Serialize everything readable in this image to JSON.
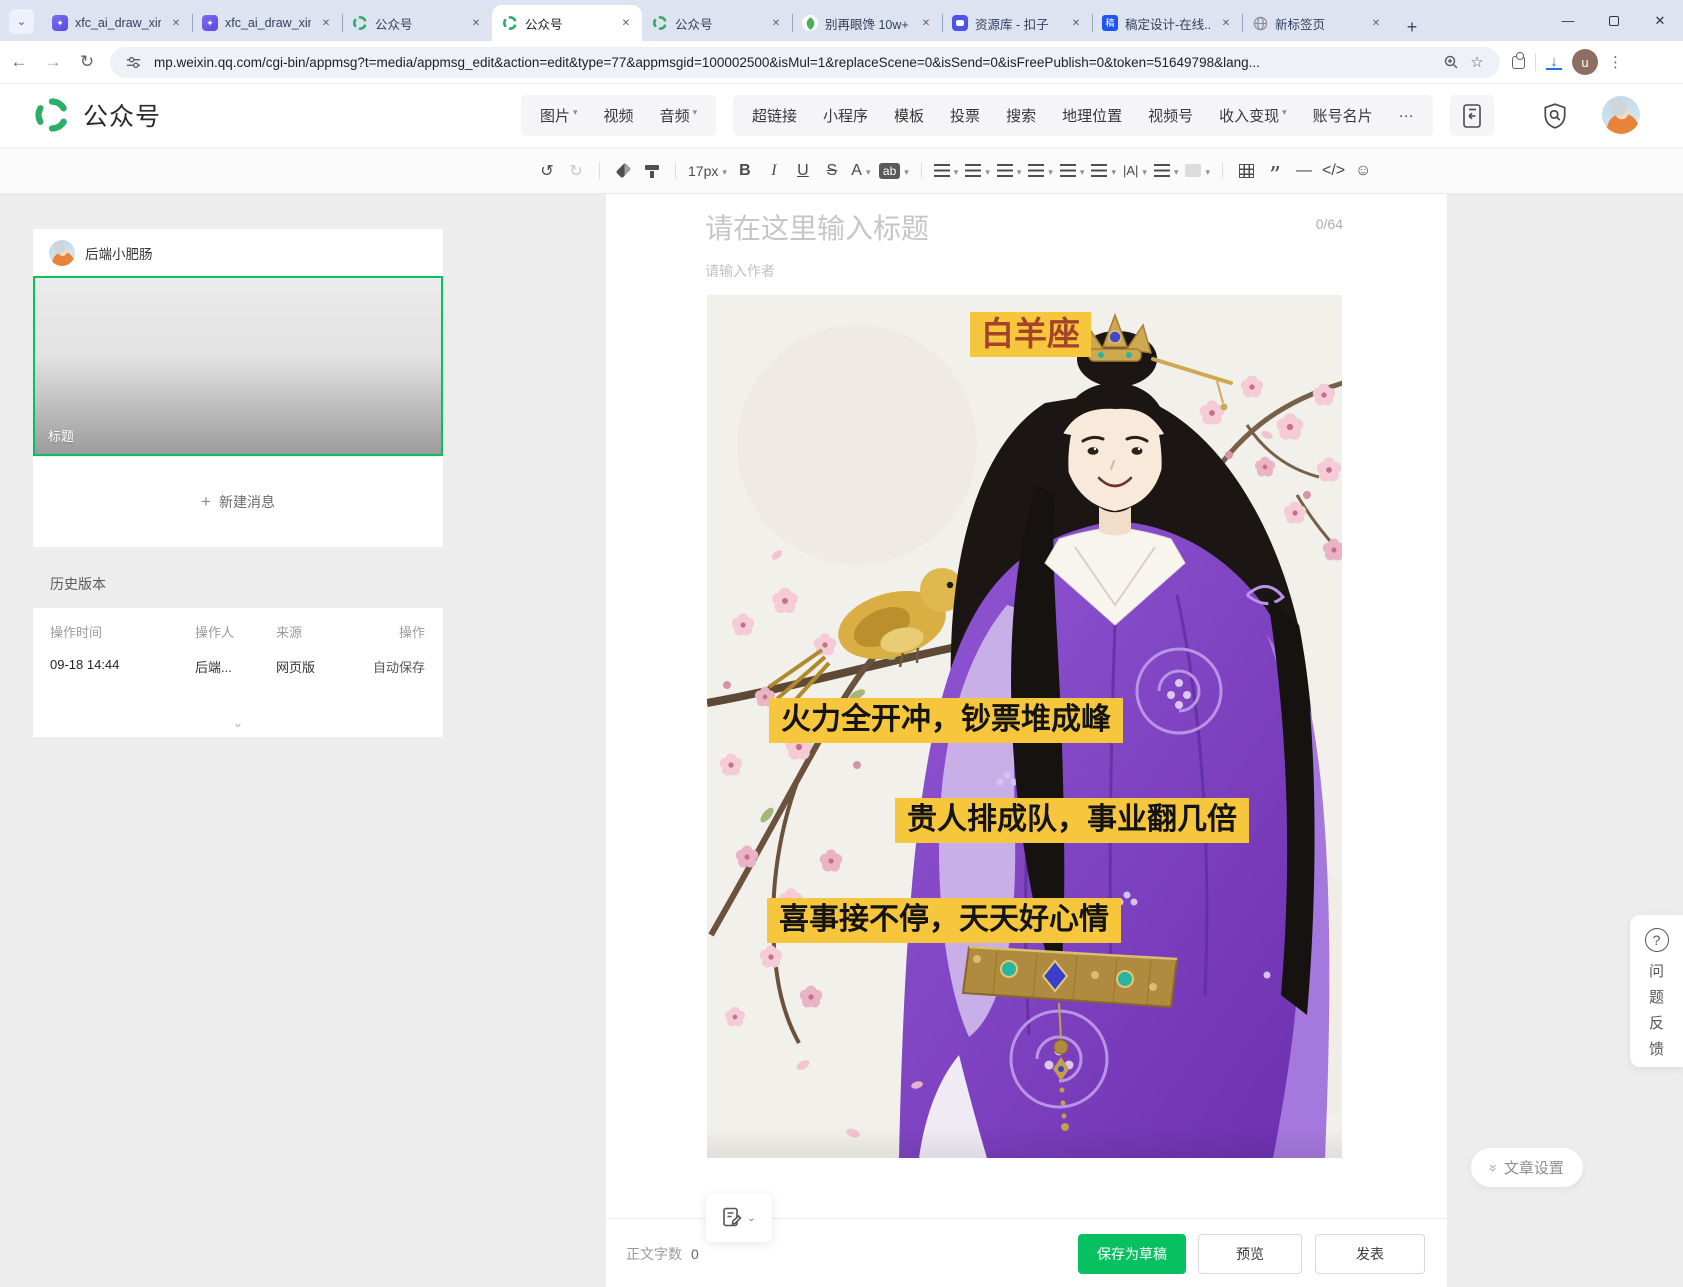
{
  "browser": {
    "tabs": [
      {
        "title": "xfc_ai_draw_xin",
        "icon": "app-purple-icon"
      },
      {
        "title": "xfc_ai_draw_xin",
        "icon": "app-purple-icon"
      },
      {
        "title": "公众号",
        "icon": "wechat-logo-icon"
      },
      {
        "title": "公众号",
        "icon": "wechat-logo-icon",
        "active": true
      },
      {
        "title": "公众号",
        "icon": "wechat-logo-icon"
      },
      {
        "title": "别再眼馋 10w+",
        "icon": "leaf-icon"
      },
      {
        "title": "资源库 - 扣子",
        "icon": "coze-icon"
      },
      {
        "title": "稿定设计-在线...",
        "icon": "gaoding-icon",
        "badge": "稿"
      },
      {
        "title": "新标签页",
        "icon": "globe-icon"
      }
    ],
    "new_tab_button": "+",
    "window": {
      "minimize": "—",
      "close": "✕"
    },
    "url": "mp.weixin.qq.com/cgi-bin/appmsg?t=media/appmsg_edit&action=edit&type=77&appmsgid=100002500&isMul=1&replaceScene=0&isSend=0&isFreePublish=0&token=51649798&lang...",
    "profile_initial": "u"
  },
  "header": {
    "brand": "公众号",
    "group1": [
      {
        "label": "图片",
        "caret": true
      },
      {
        "label": "视频"
      },
      {
        "label": "音频",
        "caret": true
      }
    ],
    "group2": [
      {
        "label": "超链接"
      },
      {
        "label": "小程序"
      },
      {
        "label": "模板"
      },
      {
        "label": "投票"
      },
      {
        "label": "搜索"
      },
      {
        "label": "地理位置"
      },
      {
        "label": "视频号"
      },
      {
        "label": "收入变现",
        "caret": true
      },
      {
        "label": "账号名片"
      },
      {
        "label": "···"
      }
    ]
  },
  "toolbar": {
    "undo": "↺",
    "redo": "↻",
    "font_size": "17px",
    "bold": "B",
    "italic": "I",
    "underline": "U",
    "strike": "S",
    "color": "A",
    "highlight": "ab",
    "letter_spacing": "|A|",
    "quote": "”",
    "hr": "—",
    "code": "</>",
    "emoji": "☺"
  },
  "sidebar": {
    "account_name": "后端小肥肠",
    "thumb_label": "标题",
    "new_message": "新建消息"
  },
  "history": {
    "title": "历史版本",
    "headers": [
      "操作时间",
      "操作人",
      "来源",
      "操作"
    ],
    "row": {
      "time": "09-18 14:44",
      "operator": "后端...",
      "source": "网页版",
      "action": "自动保存"
    }
  },
  "editor": {
    "title_placeholder": "请在这里输入标题",
    "title_counter": "0/64",
    "author_placeholder": "请输入作者"
  },
  "image_overlays": {
    "sign": "白羊座",
    "line1": "火力全开冲，钞票堆成峰",
    "line2": "贵人排成队，事业翻几倍",
    "line3": "喜事接不停，天天好心情"
  },
  "footer": {
    "word_count_label": "正文字数",
    "word_count": "0",
    "save_draft": "保存为草稿",
    "preview": "预览",
    "publish": "发表"
  },
  "floating": {
    "article_settings": "文章设置",
    "settings_chevron": "»",
    "help": "?",
    "feedback": [
      "问",
      "题",
      "反",
      "馈"
    ]
  },
  "colors": {
    "accent_green": "#07c160",
    "overlay_highlight": "#f6c63d",
    "sign_text": "#a4432a",
    "tabbar_bg": "#dee3f1"
  }
}
